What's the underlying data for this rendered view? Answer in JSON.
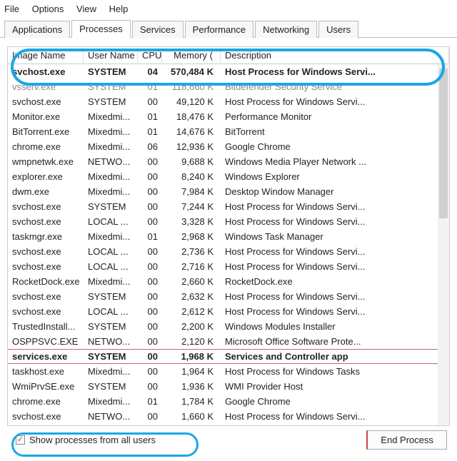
{
  "menu": {
    "file": "File",
    "options": "Options",
    "view": "View",
    "help": "Help"
  },
  "tabs": {
    "applications": "Applications",
    "processes": "Processes",
    "services": "Services",
    "performance": "Performance",
    "networking": "Networking",
    "users": "Users"
  },
  "headers": {
    "image": "Image Name",
    "user": "User Name",
    "cpu": "CPU",
    "memory": "Memory (",
    "description": "Description"
  },
  "rows": [
    {
      "img": "svchost.exe",
      "user": "SYSTEM",
      "cpu": "04",
      "mem": "570,484 K",
      "desc": "Host Process for Windows Servi...",
      "bold": true
    },
    {
      "img": "vsserv.exe",
      "user": "SYSTEM",
      "cpu": "01",
      "mem": "118,660 K",
      "desc": "Bitdefender Security Service",
      "faded": true
    },
    {
      "img": "svchost.exe",
      "user": "SYSTEM",
      "cpu": "00",
      "mem": "49,120 K",
      "desc": "Host Process for Windows Servi..."
    },
    {
      "img": "Monitor.exe",
      "user": "Mixedmi...",
      "cpu": "01",
      "mem": "18,476 K",
      "desc": "Performance Monitor"
    },
    {
      "img": "BitTorrent.exe",
      "user": "Mixedmi...",
      "cpu": "01",
      "mem": "14,676 K",
      "desc": "BitTorrent"
    },
    {
      "img": "chrome.exe",
      "user": "Mixedmi...",
      "cpu": "06",
      "mem": "12,936 K",
      "desc": "Google Chrome"
    },
    {
      "img": "wmpnetwk.exe",
      "user": "NETWO...",
      "cpu": "00",
      "mem": "9,688 K",
      "desc": "Windows Media Player Network ..."
    },
    {
      "img": "explorer.exe",
      "user": "Mixedmi...",
      "cpu": "00",
      "mem": "8,240 K",
      "desc": "Windows Explorer"
    },
    {
      "img": "dwm.exe",
      "user": "Mixedmi...",
      "cpu": "00",
      "mem": "7,984 K",
      "desc": "Desktop Window Manager"
    },
    {
      "img": "svchost.exe",
      "user": "SYSTEM",
      "cpu": "00",
      "mem": "7,244 K",
      "desc": "Host Process for Windows Servi..."
    },
    {
      "img": "svchost.exe",
      "user": "LOCAL ...",
      "cpu": "00",
      "mem": "3,328 K",
      "desc": "Host Process for Windows Servi..."
    },
    {
      "img": "taskmgr.exe",
      "user": "Mixedmi...",
      "cpu": "01",
      "mem": "2,968 K",
      "desc": "Windows Task Manager"
    },
    {
      "img": "svchost.exe",
      "user": "LOCAL ...",
      "cpu": "00",
      "mem": "2,736 K",
      "desc": "Host Process for Windows Servi..."
    },
    {
      "img": "svchost.exe",
      "user": "LOCAL ...",
      "cpu": "00",
      "mem": "2,716 K",
      "desc": "Host Process for Windows Servi..."
    },
    {
      "img": "RocketDock.exe",
      "user": "Mixedmi...",
      "cpu": "00",
      "mem": "2,660 K",
      "desc": "RocketDock.exe"
    },
    {
      "img": "svchost.exe",
      "user": "SYSTEM",
      "cpu": "00",
      "mem": "2,632 K",
      "desc": "Host Process for Windows Servi..."
    },
    {
      "img": "svchost.exe",
      "user": "LOCAL ...",
      "cpu": "00",
      "mem": "2,612 K",
      "desc": "Host Process for Windows Servi..."
    },
    {
      "img": "TrustedInstall...",
      "user": "SYSTEM",
      "cpu": "00",
      "mem": "2,200 K",
      "desc": "Windows Modules Installer"
    },
    {
      "img": "OSPPSVC.EXE",
      "user": "NETWO...",
      "cpu": "00",
      "mem": "2,120 K",
      "desc": "Microsoft Office Software Prote..."
    },
    {
      "img": "services.exe",
      "user": "SYSTEM",
      "cpu": "00",
      "mem": "1,968 K",
      "desc": "Services and Controller app",
      "bold": true,
      "services": true
    },
    {
      "img": "taskhost.exe",
      "user": "Mixedmi...",
      "cpu": "00",
      "mem": "1,964 K",
      "desc": "Host Process for Windows Tasks"
    },
    {
      "img": "WmiPrvSE.exe",
      "user": "SYSTEM",
      "cpu": "00",
      "mem": "1,936 K",
      "desc": "WMI Provider Host"
    },
    {
      "img": "chrome.exe",
      "user": "Mixedmi...",
      "cpu": "01",
      "mem": "1,784 K",
      "desc": "Google Chrome"
    },
    {
      "img": "svchost.exe",
      "user": "NETWO...",
      "cpu": "00",
      "mem": "1,660 K",
      "desc": "Host Process for Windows Servi..."
    }
  ],
  "footer": {
    "show_all": "Show processes from all users",
    "end_process": "End Process"
  }
}
